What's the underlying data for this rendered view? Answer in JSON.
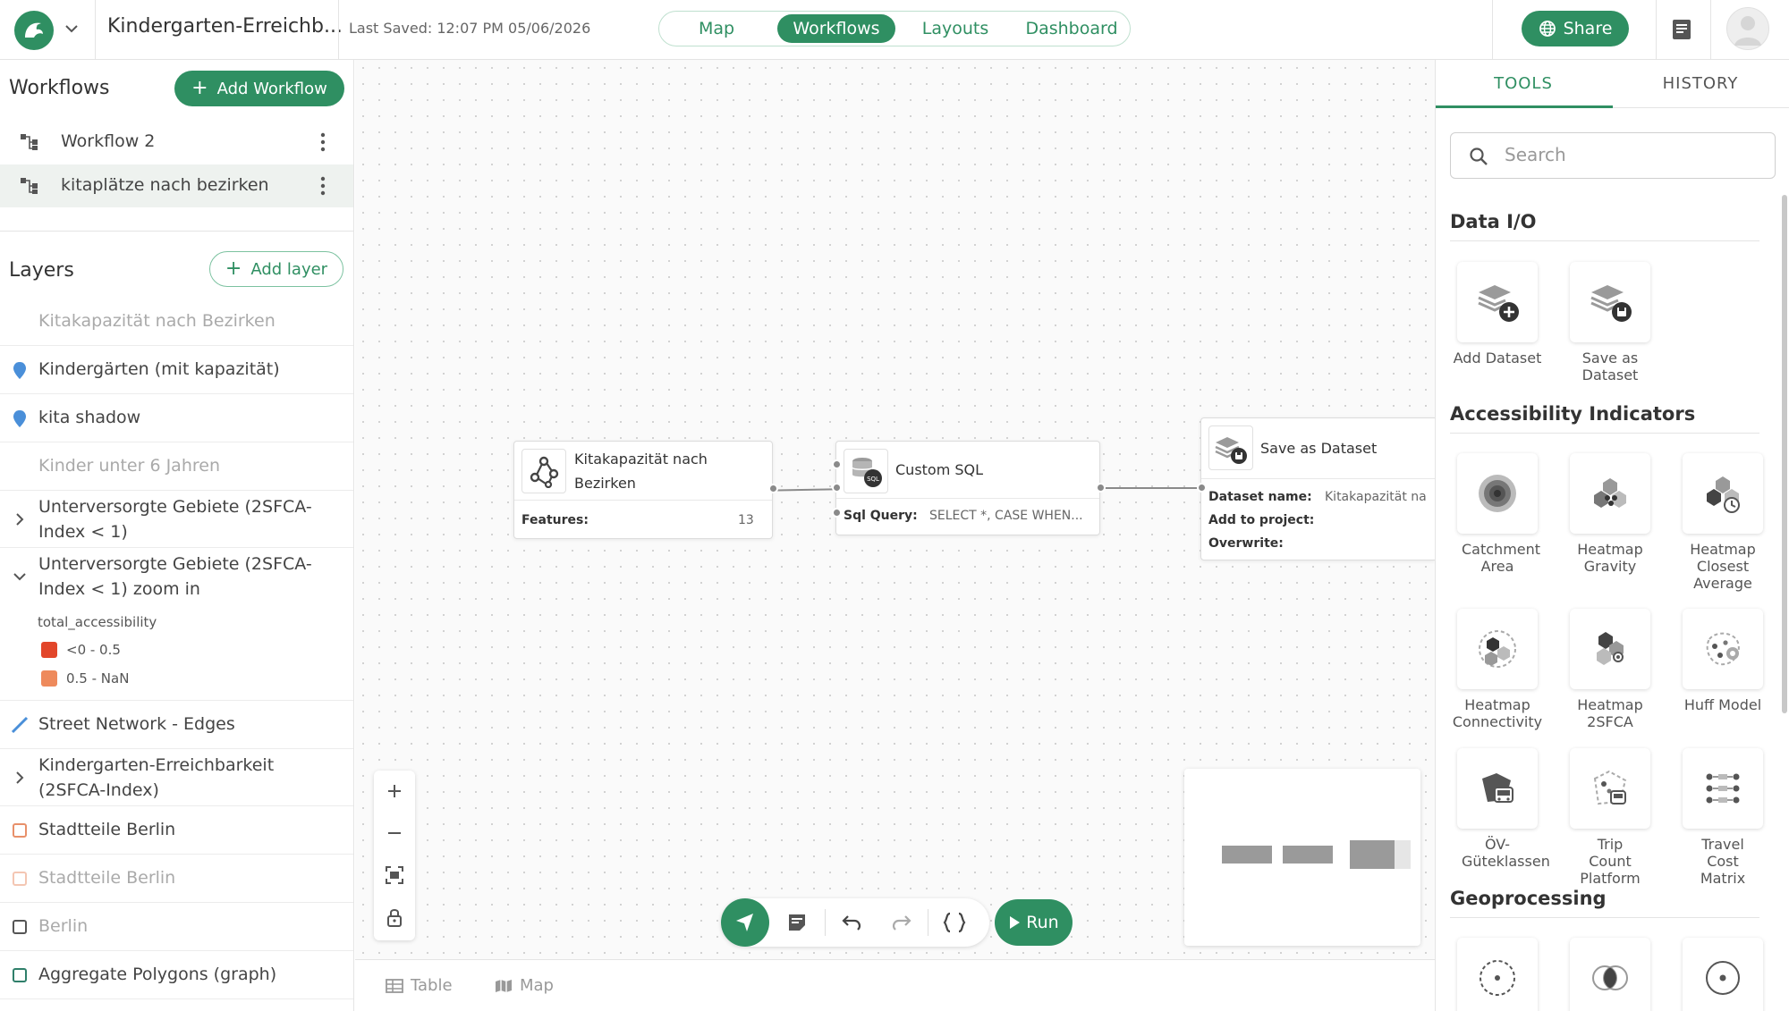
{
  "header": {
    "project_title": "Kindergarten-Erreichb...",
    "last_saved": "Last Saved: 12:07 PM 05/06/2026",
    "tabs": [
      {
        "label": "Map"
      },
      {
        "label": "Workflows"
      },
      {
        "label": "Layouts"
      },
      {
        "label": "Dashboard"
      }
    ],
    "share_label": "Share"
  },
  "workflows": {
    "title": "Workflows",
    "add_label": "Add Workflow",
    "items": [
      {
        "label": "Workflow 2"
      },
      {
        "label": "kitaplätze nach bezirken"
      }
    ]
  },
  "layers": {
    "title": "Layers",
    "add_label": "Add layer",
    "items": [
      {
        "label": "Kitakapazität nach Bezirken"
      },
      {
        "label": "Kindergärten (mit kapazität)"
      },
      {
        "label": "kita shadow"
      },
      {
        "label": "Kinder unter 6 Jahren"
      },
      {
        "label": "Unterversorgte Gebiete (2SFCA-Index < 1)"
      },
      {
        "label": "Unterversorgte Gebiete (2SFCA-Index < 1) zoom in"
      },
      {
        "label": "Street Network - Edges"
      },
      {
        "label": "Kindergarten-Erreichbarkeit (2SFCA-Index)"
      },
      {
        "label": "Stadtteile Berlin"
      },
      {
        "label": "Stadtteile Berlin"
      },
      {
        "label": "Berlin"
      },
      {
        "label": "Aggregate Polygons (graph)"
      }
    ],
    "legend": {
      "field": "total_accessibility",
      "rows": [
        {
          "label": "<0 - 0.5",
          "color": "#e2462a"
        },
        {
          "label": "0.5 - NaN",
          "color": "#ee8a5c"
        }
      ]
    }
  },
  "nodes": {
    "source": {
      "title": "Kitakapazität nach Bezirken",
      "features_label": "Features:",
      "features_value": "13"
    },
    "sql": {
      "title": "Custom SQL",
      "query_label": "Sql Query:",
      "query_value": "SELECT *, CASE WHEN..."
    },
    "save": {
      "title": "Save as Dataset",
      "name_label": "Dataset name:",
      "name_value": "Kitakapazität na",
      "project_label": "Add to project:",
      "overwrite_label": "Overwrite:"
    }
  },
  "toolbar": {
    "run_label": "Run"
  },
  "bottom_bar": {
    "table_label": "Table",
    "map_label": "Map"
  },
  "tools_panel": {
    "tabs": [
      {
        "label": "TOOLS"
      },
      {
        "label": "HISTORY"
      }
    ],
    "search_placeholder": "Search",
    "categories": [
      {
        "title": "Data I/O",
        "tools": [
          {
            "label": "Add Dataset"
          },
          {
            "label": "Save as Dataset"
          }
        ]
      },
      {
        "title": "Accessibility Indicators",
        "tools": [
          {
            "label": "Catchment Area"
          },
          {
            "label": "Heatmap Gravity"
          },
          {
            "label": "Heatmap Closest Average"
          },
          {
            "label": "Heatmap Connectivity"
          },
          {
            "label": "Heatmap 2SFCA"
          },
          {
            "label": "Huff Model"
          },
          {
            "label": "ÖV-Güteklassen"
          },
          {
            "label": "Trip Count Platform"
          },
          {
            "label": "Travel Cost Matrix"
          }
        ]
      },
      {
        "title": "Geoprocessing",
        "tools": []
      }
    ]
  },
  "colors": {
    "accent": "#2f8f62",
    "pin": "#4a8fd9",
    "orange_outline": "#e8906a"
  }
}
